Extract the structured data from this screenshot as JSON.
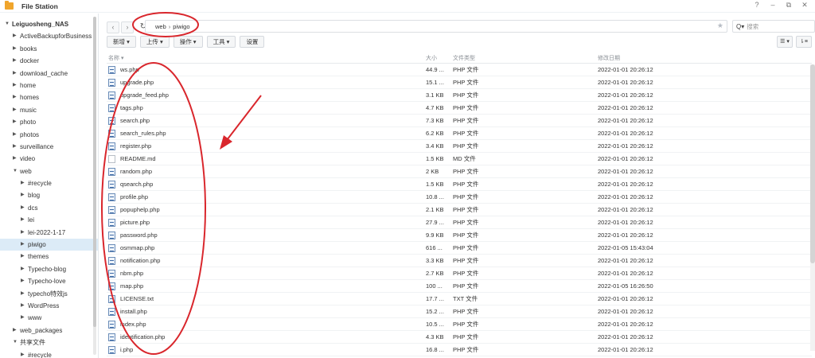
{
  "app": {
    "title": "File Station"
  },
  "window_controls": {
    "help": "?",
    "minimize": "–",
    "restore": "⧉",
    "close": "✕"
  },
  "sidebar": {
    "items": [
      {
        "label": "Leiguosheng_NAS",
        "level": 0,
        "arrow": "▼",
        "root": true
      },
      {
        "label": "ActiveBackupforBusiness",
        "level": 1,
        "arrow": "▶"
      },
      {
        "label": "books",
        "level": 1,
        "arrow": "▶"
      },
      {
        "label": "docker",
        "level": 1,
        "arrow": "▶"
      },
      {
        "label": "download_cache",
        "level": 1,
        "arrow": "▶"
      },
      {
        "label": "home",
        "level": 1,
        "arrow": "▶"
      },
      {
        "label": "homes",
        "level": 1,
        "arrow": "▶"
      },
      {
        "label": "music",
        "level": 1,
        "arrow": "▶"
      },
      {
        "label": "photo",
        "level": 1,
        "arrow": "▶"
      },
      {
        "label": "photos",
        "level": 1,
        "arrow": "▶"
      },
      {
        "label": "surveillance",
        "level": 1,
        "arrow": "▶"
      },
      {
        "label": "video",
        "level": 1,
        "arrow": "▶"
      },
      {
        "label": "web",
        "level": 1,
        "arrow": "▼"
      },
      {
        "label": "#recycle",
        "level": 2,
        "arrow": "▶"
      },
      {
        "label": "blog",
        "level": 2,
        "arrow": "▶"
      },
      {
        "label": "dcs",
        "level": 2,
        "arrow": "▶"
      },
      {
        "label": "lei",
        "level": 2,
        "arrow": "▶"
      },
      {
        "label": "lei-2022-1-17",
        "level": 2,
        "arrow": "▶"
      },
      {
        "label": "piwigo",
        "level": 2,
        "arrow": "▶",
        "selected": true
      },
      {
        "label": "themes",
        "level": 2,
        "arrow": "▶"
      },
      {
        "label": "Typecho-blog",
        "level": 2,
        "arrow": "▶"
      },
      {
        "label": "Typecho-love",
        "level": 2,
        "arrow": "▶"
      },
      {
        "label": "typecho特效js",
        "level": 2,
        "arrow": "▶"
      },
      {
        "label": "WordPress",
        "level": 2,
        "arrow": "▶"
      },
      {
        "label": "www",
        "level": 2,
        "arrow": "▶"
      },
      {
        "label": "web_packages",
        "level": 1,
        "arrow": "▶"
      },
      {
        "label": "共享文件",
        "level": 1,
        "arrow": "▼"
      },
      {
        "label": "#recycle",
        "level": 2,
        "arrow": "▶"
      }
    ]
  },
  "nav": {
    "back": "‹",
    "forward": "›",
    "refresh": "↻"
  },
  "path": {
    "segments": [
      "web",
      "piwigo"
    ],
    "separator": "›"
  },
  "search": {
    "icon": "search-icon",
    "placeholder": "搜索"
  },
  "toolbar": {
    "new": "新增 ▾",
    "upload": "上传 ▾",
    "action": "操作 ▾",
    "tools": "工具 ▾",
    "settings": "设置"
  },
  "view": {
    "list": "☰ ▾",
    "sort": "⇂≡"
  },
  "columns": {
    "name": "名称 ▾",
    "size": "大小",
    "type": "文件类型",
    "modified": "修改日期"
  },
  "files": [
    {
      "name": "ws.php",
      "size": "44.9 ...",
      "type": "PHP 文件",
      "date": "2022-01-01 20:26:12"
    },
    {
      "name": "upgrade.php",
      "size": "15.1 ...",
      "type": "PHP 文件",
      "date": "2022-01-01 20:26:12"
    },
    {
      "name": "upgrade_feed.php",
      "size": "3.1 KB",
      "type": "PHP 文件",
      "date": "2022-01-01 20:26:12"
    },
    {
      "name": "tags.php",
      "size": "4.7 KB",
      "type": "PHP 文件",
      "date": "2022-01-01 20:26:12"
    },
    {
      "name": "search.php",
      "size": "7.3 KB",
      "type": "PHP 文件",
      "date": "2022-01-01 20:26:12"
    },
    {
      "name": "search_rules.php",
      "size": "6.2 KB",
      "type": "PHP 文件",
      "date": "2022-01-01 20:26:12"
    },
    {
      "name": "register.php",
      "size": "3.4 KB",
      "type": "PHP 文件",
      "date": "2022-01-01 20:26:12"
    },
    {
      "name": "README.md",
      "size": "1.5 KB",
      "type": "MD 文件",
      "date": "2022-01-01 20:26:12",
      "kind": "md"
    },
    {
      "name": "random.php",
      "size": "2 KB",
      "type": "PHP 文件",
      "date": "2022-01-01 20:26:12"
    },
    {
      "name": "qsearch.php",
      "size": "1.5 KB",
      "type": "PHP 文件",
      "date": "2022-01-01 20:26:12"
    },
    {
      "name": "profile.php",
      "size": "10.8 ...",
      "type": "PHP 文件",
      "date": "2022-01-01 20:26:12"
    },
    {
      "name": "popuphelp.php",
      "size": "2.1 KB",
      "type": "PHP 文件",
      "date": "2022-01-01 20:26:12"
    },
    {
      "name": "picture.php",
      "size": "27.9 ...",
      "type": "PHP 文件",
      "date": "2022-01-01 20:26:12"
    },
    {
      "name": "password.php",
      "size": "9.9 KB",
      "type": "PHP 文件",
      "date": "2022-01-01 20:26:12"
    },
    {
      "name": "osmmap.php",
      "size": "616 ...",
      "type": "PHP 文件",
      "date": "2022-01-05 15:43:04"
    },
    {
      "name": "notification.php",
      "size": "3.3 KB",
      "type": "PHP 文件",
      "date": "2022-01-01 20:26:12"
    },
    {
      "name": "nbm.php",
      "size": "2.7 KB",
      "type": "PHP 文件",
      "date": "2022-01-01 20:26:12"
    },
    {
      "name": "map.php",
      "size": "100 ...",
      "type": "PHP 文件",
      "date": "2022-01-05 16:26:50"
    },
    {
      "name": "LICENSE.txt",
      "size": "17.7 ...",
      "type": "TXT 文件",
      "date": "2022-01-01 20:26:12"
    },
    {
      "name": "install.php",
      "size": "15.2 ...",
      "type": "PHP 文件",
      "date": "2022-01-01 20:26:12"
    },
    {
      "name": "index.php",
      "size": "10.5 ...",
      "type": "PHP 文件",
      "date": "2022-01-01 20:26:12"
    },
    {
      "name": "identification.php",
      "size": "4.3 KB",
      "type": "PHP 文件",
      "date": "2022-01-01 20:26:12"
    },
    {
      "name": "i.php",
      "size": "16.8 ...",
      "type": "PHP 文件",
      "date": "2022-01-01 20:26:12"
    }
  ],
  "colors": {
    "selected": "#dcebf7",
    "annotation": "#d9262c",
    "folder": "#f0a52c"
  }
}
